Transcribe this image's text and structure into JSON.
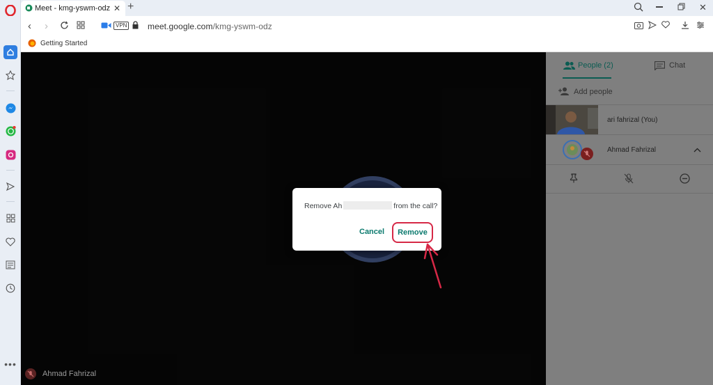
{
  "browser": {
    "tab_title": "Meet - kmg-yswm-odz",
    "new_tab_glyph": "+",
    "url_host": "meet.google.com",
    "url_path": "/kmg-yswm-odz",
    "vpn_label": "VPN",
    "bookmark_label": "Getting Started"
  },
  "sidebar_icons": [
    "opera-logo-icon",
    "home-icon",
    "bookmark-star-icon",
    "messenger-icon",
    "whatsapp-icon",
    "instagram-icon",
    "send-icon",
    "speed-dial-icon",
    "heart-icon",
    "news-icon",
    "history-icon",
    "more-icon"
  ],
  "panel": {
    "people_tab": "People (2)",
    "chat_tab": "Chat",
    "add_people": "Add people",
    "participants": [
      {
        "name": "ari fahrizal (You)"
      },
      {
        "name": "Ahmad Fahrizal"
      }
    ]
  },
  "stage": {
    "self_label": "Ahmad Fahrizal"
  },
  "dialog": {
    "msg_prefix": "Remove Ah",
    "msg_suffix": "from the call?",
    "cancel_label": "Cancel",
    "remove_label": "Remove"
  },
  "colors": {
    "accent": "#0b7a6e",
    "annotation": "#d62846"
  }
}
